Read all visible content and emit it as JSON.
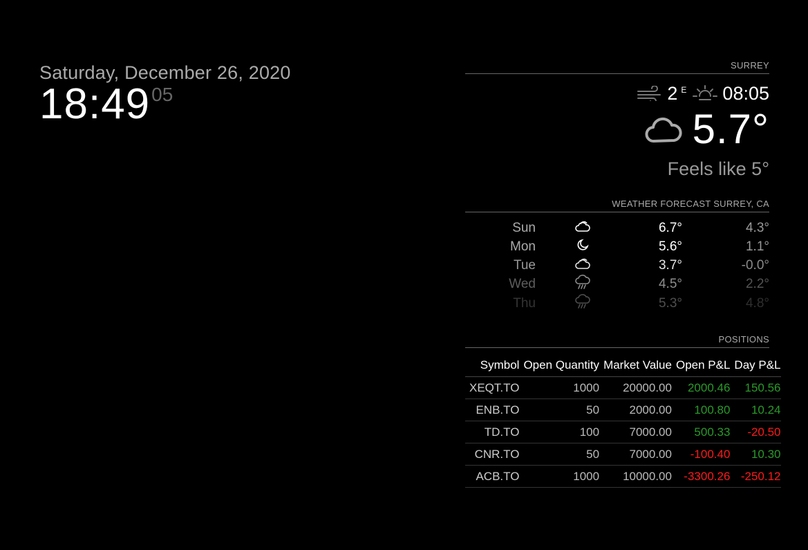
{
  "clock": {
    "date": "Saturday, December 26, 2020",
    "hours_minutes": "18:49",
    "seconds": "05"
  },
  "current_weather": {
    "header": "SURREY",
    "wind_speed": "2",
    "wind_direction": "E",
    "sunrise_time": "08:05",
    "temperature": "5.7°",
    "feels_like": "Feels like 5°",
    "icons": {
      "wind": "wind-icon",
      "sun": "sunrise-icon",
      "condition": "cloudy-icon"
    }
  },
  "forecast": {
    "header": "WEATHER FORECAST SURREY, CA",
    "days": [
      {
        "day": "Sun",
        "icon": "partly-cloudy-icon",
        "max": "6.7°",
        "min": "4.3°"
      },
      {
        "day": "Mon",
        "icon": "moon-icon",
        "max": "5.6°",
        "min": "1.1°"
      },
      {
        "day": "Tue",
        "icon": "partly-cloudy-icon",
        "max": "3.7°",
        "min": "-0.0°"
      },
      {
        "day": "Wed",
        "icon": "rain-icon",
        "max": "4.5°",
        "min": "2.2°"
      },
      {
        "day": "Thu",
        "icon": "rain-icon",
        "max": "5.3°",
        "min": "4.8°"
      }
    ]
  },
  "positions": {
    "header": "POSITIONS",
    "columns": [
      "Symbol",
      "Open Quantity",
      "Market Value",
      "Open P&L",
      "Day P&L"
    ],
    "rows": [
      {
        "symbol": "XEQT.TO",
        "qty": "1000",
        "value": "20000.00",
        "open_pl": "2000.46",
        "day_pl": "150.56"
      },
      {
        "symbol": "ENB.TO",
        "qty": "50",
        "value": "2000.00",
        "open_pl": "100.80",
        "day_pl": "10.24"
      },
      {
        "symbol": "TD.TO",
        "qty": "100",
        "value": "7000.00",
        "open_pl": "500.33",
        "day_pl": "-20.50"
      },
      {
        "symbol": "CNR.TO",
        "qty": "50",
        "value": "7000.00",
        "open_pl": "-100.40",
        "day_pl": "10.30"
      },
      {
        "symbol": "ACB.TO",
        "qty": "1000",
        "value": "10000.00",
        "open_pl": "-3300.26",
        "day_pl": "-250.12"
      }
    ],
    "colors": {
      "positive": "#2a9a2a",
      "negative": "#ff1a1a"
    }
  }
}
